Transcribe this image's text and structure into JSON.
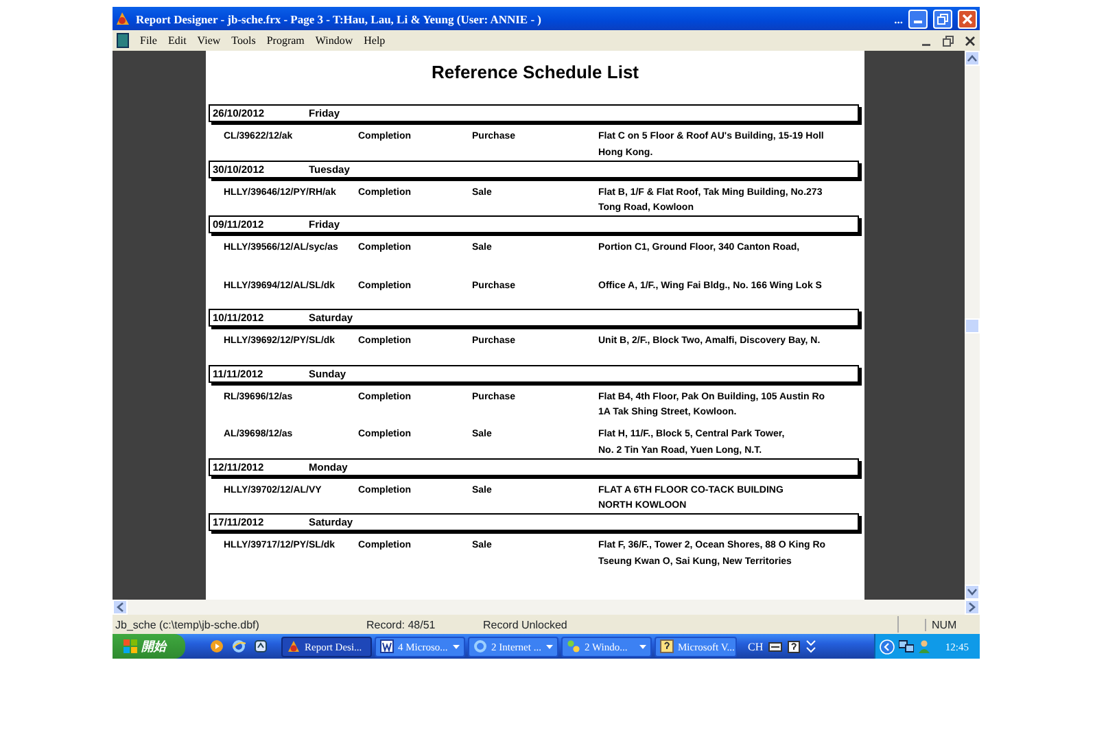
{
  "window": {
    "title": "Report Designer - jb-sche.frx - Page 3 - T:Hau, Lau, Li & Yeung  (User: ANNIE - )",
    "overflow_mark": "..."
  },
  "menu": [
    "File",
    "Edit",
    "View",
    "Tools",
    "Program",
    "Window",
    "Help"
  ],
  "report": {
    "title": "Reference Schedule List",
    "groups": [
      {
        "date": "26/10/2012",
        "day": "Friday",
        "entries": [
          {
            "ref": "CL/39622/12/ak",
            "type": "Completion",
            "side": "Purchase",
            "address": [
              "Flat C on 5 Floor & Roof AU's Building, 15-19 Holl",
              "Hong Kong."
            ]
          }
        ]
      },
      {
        "date": "30/10/2012",
        "day": "Tuesday",
        "entries": [
          {
            "ref": "HLLY/39646/12/PY/RH/ak",
            "type": "Completion",
            "side": "Sale",
            "address": [
              "Flat B, 1/F & Flat Roof, Tak Ming Building, No.273",
              "Tong Road, Kowloon"
            ]
          }
        ]
      },
      {
        "date": "09/11/2012",
        "day": "Friday",
        "entries": [
          {
            "ref": "HLLY/39566/12/AL/syc/as",
            "type": "Completion",
            "side": "Sale",
            "address": [
              "Portion C1, Ground Floor, 340 Canton Road,"
            ]
          },
          {
            "ref": "HLLY/39694/12/AL/SL/dk",
            "type": "Completion",
            "side": "Purchase",
            "address": [
              "Office A, 1/F., Wing Fai Bldg., No. 166 Wing Lok S"
            ]
          }
        ]
      },
      {
        "date": "10/11/2012",
        "day": "Saturday",
        "entries": [
          {
            "ref": "HLLY/39692/12/PY/SL/dk",
            "type": "Completion",
            "side": "Purchase",
            "address": [
              "Unit B, 2/F., Block Two, Amalfi, Discovery Bay, N."
            ]
          }
        ]
      },
      {
        "date": "11/11/2012",
        "day": "Sunday",
        "entries": [
          {
            "ref": "RL/39696/12/as",
            "type": "Completion",
            "side": "Purchase",
            "address": [
              "Flat B4, 4th Floor, Pak On Building, 105 Austin Ro",
              "1A Tak Shing Street, Kowloon."
            ]
          },
          {
            "ref": "AL/39698/12/as",
            "type": "Completion",
            "side": "Sale",
            "address": [
              "Flat H, 11/F., Block 5, Central Park Tower,",
              "No. 2 Tin Yan Road, Yuen Long, N.T."
            ]
          }
        ]
      },
      {
        "date": "12/11/2012",
        "day": "Monday",
        "entries": [
          {
            "ref": "HLLY/39702/12/AL/VY",
            "type": "Completion",
            "side": "Sale",
            "address": [
              "FLAT A 6TH FLOOR CO-TACK BUILDING",
              "NORTH KOWLOON"
            ]
          }
        ]
      },
      {
        "date": "17/11/2012",
        "day": "Saturday",
        "entries": [
          {
            "ref": "HLLY/39717/12/PY/SL/dk",
            "type": "Completion",
            "side": "Sale",
            "address": [
              "Flat F, 36/F., Tower 2, Ocean Shores, 88 O King Ro",
              "Tseung Kwan O, Sai Kung, New Territories"
            ]
          }
        ]
      }
    ]
  },
  "status_bar": [
    "Jb_sche (c:\\temp\\jb-sche.dbf)",
    "Record: 48/51",
    "Record Unlocked",
    "NUM"
  ],
  "taskbar": {
    "start": "開始",
    "tasks": [
      {
        "label": "Report Desi...",
        "kind": "app",
        "selected": true,
        "grouped": false
      },
      {
        "label": "4 Microso...",
        "kind": "word",
        "selected": false,
        "grouped": true
      },
      {
        "label": "2 Internet ...",
        "kind": "browser",
        "selected": false,
        "grouped": true
      },
      {
        "label": "2 Windo...",
        "kind": "folder",
        "selected": false,
        "grouped": true
      },
      {
        "label": "Microsoft V...",
        "kind": "help",
        "selected": false,
        "grouped": false
      }
    ],
    "language": "CH",
    "clock": "12:45"
  }
}
